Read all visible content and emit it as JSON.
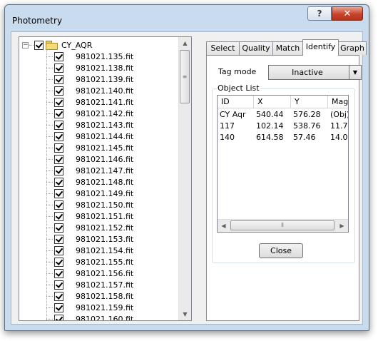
{
  "window": {
    "title": "Photometry",
    "help_glyph": "?",
    "close_glyph": "✕"
  },
  "tree": {
    "root_label": "CY_AQR",
    "expander_glyph": "−",
    "items": [
      "981021.135.fit",
      "981021.138.fit",
      "981021.139.fit",
      "981021.140.fit",
      "981021.141.fit",
      "981021.142.fit",
      "981021.143.fit",
      "981021.144.fit",
      "981021.145.fit",
      "981021.146.fit",
      "981021.147.fit",
      "981021.148.fit",
      "981021.149.fit",
      "981021.150.fit",
      "981021.151.fit",
      "981021.152.fit",
      "981021.153.fit",
      "981021.154.fit",
      "981021.155.fit",
      "981021.156.fit",
      "981021.157.fit",
      "981021.158.fit",
      "981021.159.fit",
      "981021.160.fit"
    ]
  },
  "tabs": [
    "Select",
    "Quality",
    "Match",
    "Identify",
    "Graph"
  ],
  "active_tab": "Identify",
  "identify": {
    "tag_mode_label": "Tag mode",
    "tag_mode_value": "Inactive",
    "object_list_label": "Object List",
    "columns": [
      "ID",
      "X",
      "Y",
      "Mag"
    ],
    "rows": [
      [
        "CY Aqr",
        "540.44",
        "576.28",
        "(Obj)"
      ],
      [
        "117",
        "102.14",
        "538.76",
        "11.7"
      ],
      [
        "140",
        "614.58",
        "57.46",
        "14.0"
      ]
    ],
    "close_label": "Close"
  }
}
